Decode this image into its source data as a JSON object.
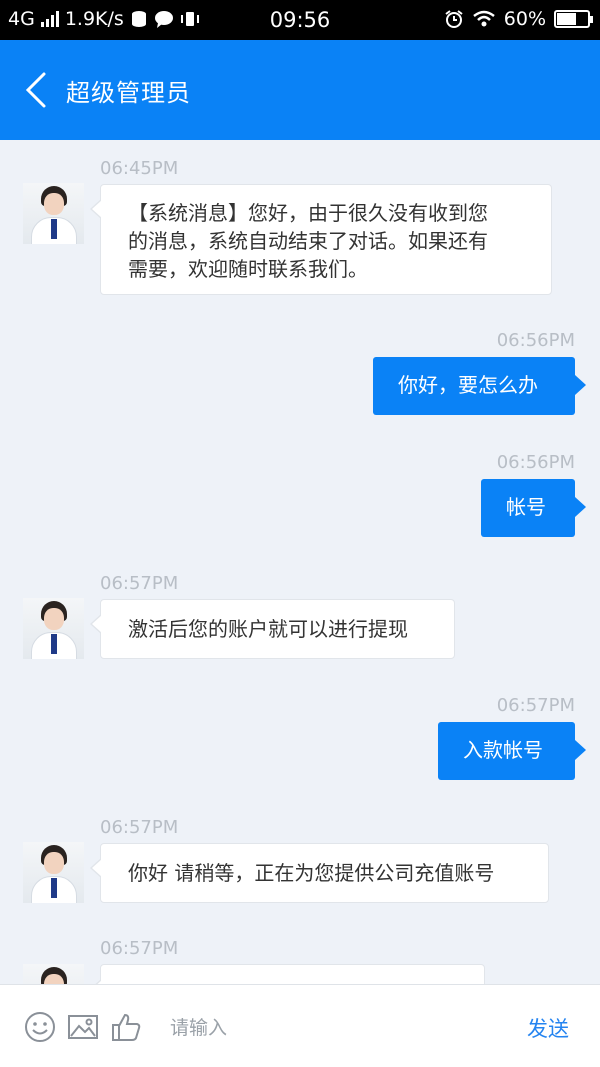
{
  "status_bar": {
    "network": "4G",
    "speed": "1.9K/s",
    "time": "09:56",
    "battery": "60%"
  },
  "header": {
    "title": "超级管理员",
    "icons": {
      "back": "chevron-left-icon"
    }
  },
  "messages": [
    {
      "time": "06:45PM",
      "side": "left",
      "lines": [
        "【系统消息】您好，由于很久没有收到您",
        "的消息，系统自动结束了对话。如果还有",
        "需要，欢迎随时联系我们。"
      ]
    },
    {
      "time": "06:56PM",
      "side": "right",
      "text": "你好，要怎么办"
    },
    {
      "time": "06:56PM",
      "side": "right",
      "text": "帐号"
    },
    {
      "time": "06:57PM",
      "side": "left",
      "text": "激活后您的账户就可以进行提现"
    },
    {
      "time": "06:57PM",
      "side": "right",
      "text": "入款帐号"
    },
    {
      "time": "06:57PM",
      "side": "left",
      "text": "你好 请稍等，正在为您提供公司充值账号"
    },
    {
      "time": "06:57PM",
      "side": "left",
      "text": ""
    }
  ],
  "input_bar": {
    "placeholder": "请输入",
    "send_label": "发送",
    "icons": [
      "smiley-icon",
      "image-icon",
      "thumbs-up-icon"
    ]
  },
  "colors": {
    "accent": "#0a82f6",
    "background": "#eef2f8",
    "timestamp": "#b8bec6"
  }
}
